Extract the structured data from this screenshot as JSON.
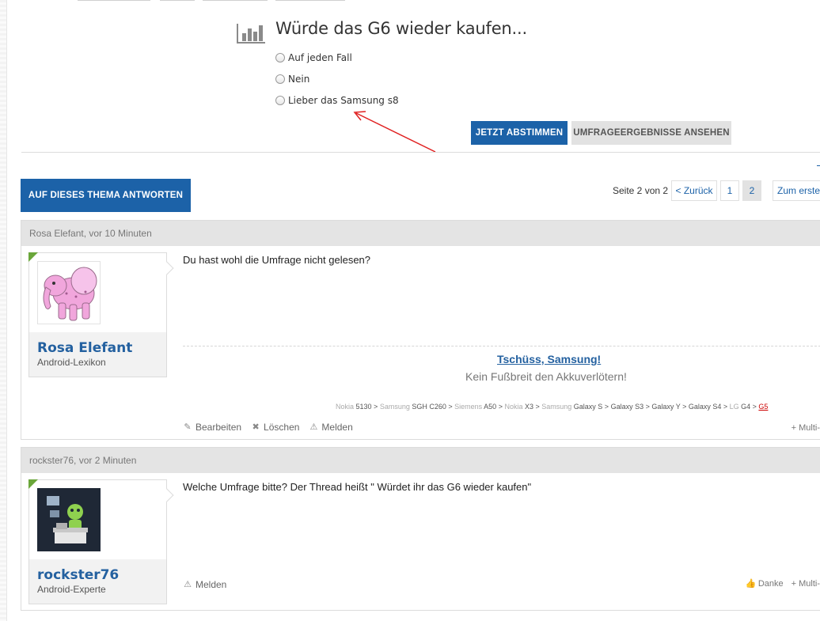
{
  "poll": {
    "title": "Würde das G6 wieder kaufen...",
    "options": [
      "Auf jeden Fall",
      "Nein",
      "Lieber das Samsung s8"
    ],
    "vote_label": "JETZT ABSTIMMEN",
    "results_label": "UMFRAGEERGEBNISSE ANSEHEN"
  },
  "toolbar": {
    "reply_label": "AUF DIESES THEMA ANTWORTEN"
  },
  "pagination": {
    "page_label": "Seite 2 von 2",
    "prev_label": "< Zurück",
    "pages": [
      "1",
      "2"
    ],
    "first_label": "Zum erste"
  },
  "posts": [
    {
      "header": "Rosa Elefant, vor 10 Minuten",
      "user_name": "Rosa Elefant",
      "user_title": "Android-Lexikon",
      "text": "Du hast wohl die Umfrage nicht gelesen?",
      "signature": {
        "title": "Tschüss, Samsung!",
        "subtitle": "Kein Fußbreit den Akkuverlötern!",
        "parts": [
          {
            "brand": "Nokia",
            "model": "5130"
          },
          {
            "brand": "Samsung",
            "model": "SGH C260"
          },
          {
            "brand": "Siemens",
            "model": "A50"
          },
          {
            "brand": "Nokia",
            "model": "X3"
          },
          {
            "brand": "Samsung",
            "model": "Galaxy S"
          },
          {
            "brand": "",
            "model": "Galaxy S3"
          },
          {
            "brand": "",
            "model": "Galaxy Y"
          },
          {
            "brand": "",
            "model": "Galaxy S4"
          },
          {
            "brand": "LG",
            "model": "G4"
          },
          {
            "brand": "",
            "model": "G5"
          }
        ]
      },
      "actions": [
        "Bearbeiten",
        "Löschen",
        "Melden"
      ],
      "right_actions": [
        "+ Multi-"
      ]
    },
    {
      "header": "rockster76, vor 2 Minuten",
      "user_name": "rockster76",
      "user_title": "Android-Experte",
      "text": "Welche Umfrage bitte? Der Thread heißt \" Würdet ihr das G6 wieder kaufen\"",
      "actions": [
        "Melden"
      ],
      "right_actions": [
        "Danke",
        "+ Multi-"
      ]
    }
  ],
  "colors": {
    "primary": "#1c62a8",
    "username": "#2461a0",
    "header_bg": "#e4e4e4",
    "rank_triangle": "#6aa63a",
    "annotation_arrow": "#e02020"
  }
}
